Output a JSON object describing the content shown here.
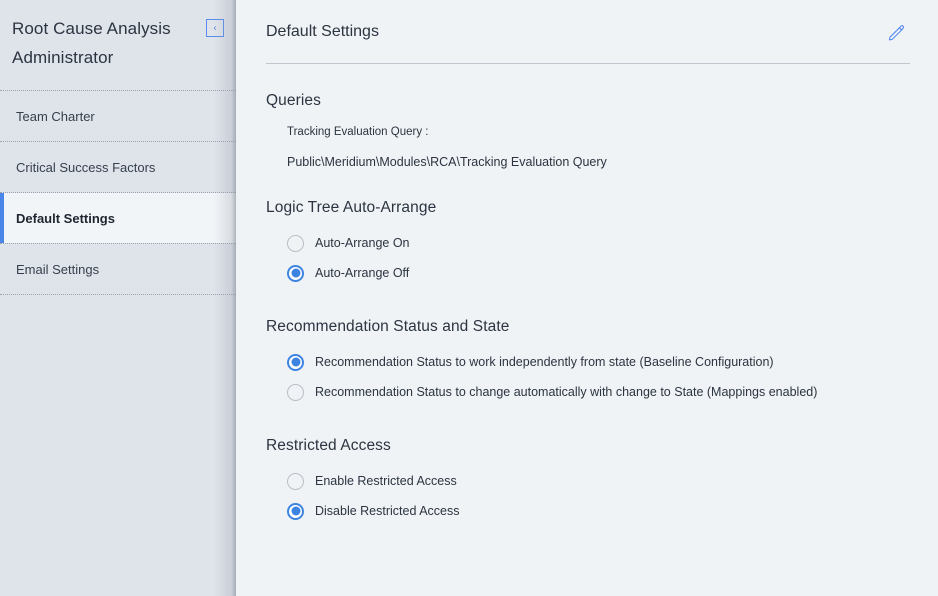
{
  "sidebar": {
    "title": "Root Cause Analysis Administrator",
    "collapse_icon": "chevron-left-icon",
    "collapse_glyph": "‹",
    "items": [
      {
        "label": "Team Charter",
        "active": false
      },
      {
        "label": "Critical Success Factors",
        "active": false
      },
      {
        "label": "Default Settings",
        "active": true
      },
      {
        "label": "Email Settings",
        "active": false
      }
    ]
  },
  "main": {
    "title": "Default Settings",
    "edit_icon": "pencil-edit-icon",
    "sections": [
      {
        "heading": "Queries",
        "query_label": "Tracking Evaluation Query :",
        "query_value": "Public\\Meridium\\Modules\\RCA\\Tracking Evaluation Query"
      },
      {
        "heading": "Logic Tree Auto-Arrange",
        "options": [
          {
            "label": "Auto-Arrange On",
            "selected": false
          },
          {
            "label": "Auto-Arrange Off",
            "selected": true
          }
        ]
      },
      {
        "heading": "Recommendation Status and State",
        "options": [
          {
            "label": "Recommendation Status to work independently from state (Baseline Configuration)",
            "selected": true
          },
          {
            "label": "Recommendation Status to change automatically with change to State (Mappings enabled)",
            "selected": false
          }
        ]
      },
      {
        "heading": "Restricted Access",
        "options": [
          {
            "label": "Enable Restricted Access",
            "selected": false
          },
          {
            "label": "Disable Restricted Access",
            "selected": true
          }
        ]
      }
    ]
  },
  "colors": {
    "accent": "#4a86e8",
    "radio_selected": "#3d84e0",
    "sidebar_bg": "#dfe3ea",
    "main_bg": "#f0f3f6",
    "text": "#2b3440"
  }
}
